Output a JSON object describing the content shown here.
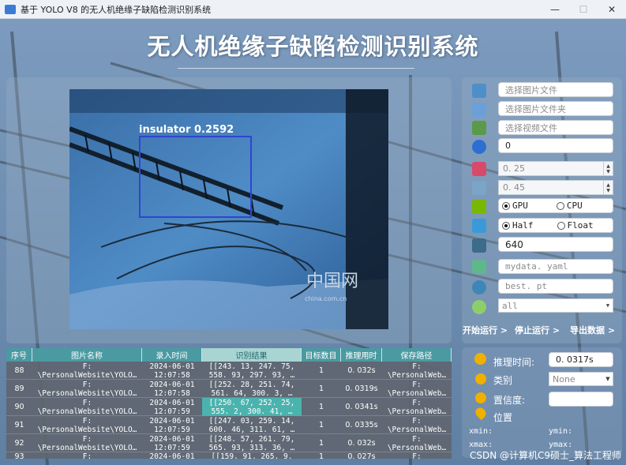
{
  "window": {
    "title": "基于 YOLO V8 的无人机绝缘子缺陷检测识别系统",
    "minimize": "—",
    "maximize": "☐",
    "close": "✕"
  },
  "app_title": "无人机绝缘子缺陷检测识别系统",
  "detection": {
    "label": "insulator 0.2592",
    "box_color": "#2f45d0"
  },
  "viewer": {
    "watermark_cn": "中国网",
    "watermark_en": "china.com.cn"
  },
  "controls": {
    "select_image_placeholder": "选择图片文件",
    "select_folder_placeholder": "选择图片文件夹",
    "select_video_placeholder": "选择视频文件",
    "camera_value": "0",
    "iou_value": "0. 25",
    "conf_value": "0. 45",
    "device_options": [
      "GPU",
      "CPU"
    ],
    "device_selected": "GPU",
    "precision_options": [
      "Half",
      "Float"
    ],
    "precision_selected": "Half",
    "img_size": "640",
    "data_file_placeholder": "mydata. yaml",
    "weights_placeholder": "best. pt",
    "class_select": "all"
  },
  "actions": {
    "start": "开始运行 >",
    "stop": "停止运行 >",
    "export": "导出数据 >"
  },
  "table": {
    "headers": [
      "序号",
      "图片名称",
      "录入时间",
      "识别结果",
      "目标数目",
      "推理用时",
      "保存路径"
    ],
    "rows": [
      {
        "no": "88",
        "name1": "F:",
        "name2": "\\PersonalWebsite\\YOLO…",
        "t1": "2024-06-01",
        "t2": "12:07:58",
        "r1": "[[243. 13,  247. 75,",
        "r2": "558. 93,  297. 93,  …",
        "count": "1",
        "time": "0. 032s",
        "p1": "F:",
        "p2": "\\PersonalWeb…"
      },
      {
        "no": "89",
        "name1": "F:",
        "name2": "\\PersonalWebsite\\YOLO…",
        "t1": "2024-06-01",
        "t2": "12:07:58",
        "r1": "[[252. 28,  251. 74,",
        "r2": "561. 64,  300. 3,  …",
        "count": "1",
        "time": "0. 0319s",
        "p1": "F:",
        "p2": "\\PersonalWeb…"
      },
      {
        "no": "90",
        "name1": "F:",
        "name2": "\\PersonalWebsite\\YOLO…",
        "t1": "2024-06-01",
        "t2": "12:07:59",
        "r1": "[[250. 67,  252. 25,",
        "r2": "555. 2,  300. 41,  …",
        "count": "1",
        "time": "0. 0341s",
        "p1": "F:",
        "p2": "\\PersonalWeb…"
      },
      {
        "no": "91",
        "name1": "F:",
        "name2": "\\PersonalWebsite\\YOLO…",
        "t1": "2024-06-01",
        "t2": "12:07:59",
        "r1": "[[247. 03,  259. 14,",
        "r2": "600. 46,  311. 61,  …",
        "count": "1",
        "time": "0. 0335s",
        "p1": "F:",
        "p2": "\\PersonalWeb…"
      },
      {
        "no": "92",
        "name1": "F:",
        "name2": "\\PersonalWebsite\\YOLO…",
        "t1": "2024-06-01",
        "t2": "12:07:59",
        "r1": "[[248. 57,  261. 79,",
        "r2": "565. 93,  313. 36,  …",
        "count": "1",
        "time": "0. 032s",
        "p1": "F:",
        "p2": "\\PersonalWeb…"
      },
      {
        "no": "93",
        "name1": "F:",
        "name2": "",
        "t1": "2024-06-01",
        "t2": "",
        "r1": "[[159. 91,  265. 9,",
        "r2": "",
        "count": "1",
        "time": "0. 027s",
        "p1": "F:",
        "p2": ""
      }
    ]
  },
  "info": {
    "infer_label": "推理时间:",
    "infer_value": "0. 0317s",
    "class_label": "类别",
    "class_value": "None",
    "conf_label": "置信度:",
    "conf_value": "",
    "pos_label": "位置",
    "xmin": "xmin:",
    "ymin": "ymin:",
    "xmax": "xmax:",
    "ymax": "ymax:"
  },
  "credit": "CSDN @计算机C9硕士_算法工程师"
}
